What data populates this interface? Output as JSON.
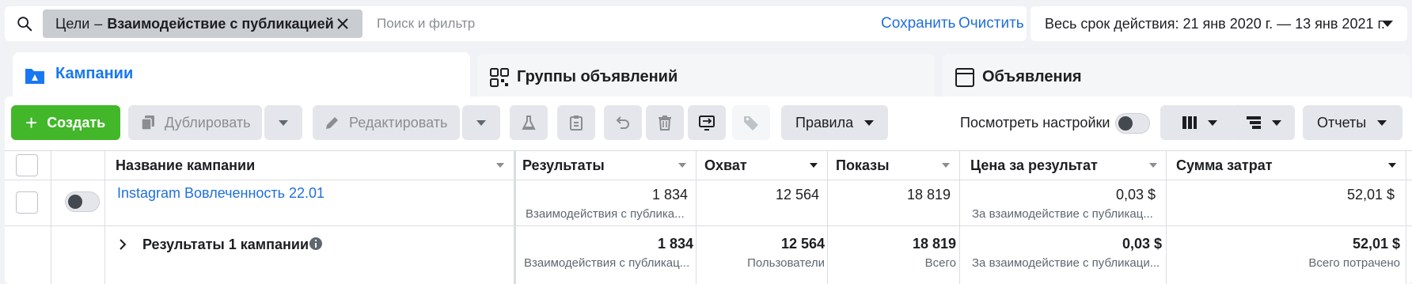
{
  "search": {
    "chip_prefix": "Цели",
    "chip_separator": "–",
    "chip_value": "Взаимодействие с публикацией",
    "placeholder": "Поиск и фильтр",
    "save_label": "Сохранить",
    "clear_label": "Очистить"
  },
  "date_range": {
    "label": "Весь срок действия: 21 янв 2020 г. — 13 янв 2021 г."
  },
  "tabs": [
    {
      "label": "Кампании",
      "active": true,
      "icon": "folder-icon"
    },
    {
      "label": "Группы объявлений",
      "active": false,
      "icon": "grid-icon"
    },
    {
      "label": "Объявления",
      "active": false,
      "icon": "ad-window-icon"
    }
  ],
  "toolbar": {
    "create_label": "Создать",
    "duplicate_label": "Дублировать",
    "edit_label": "Редактировать",
    "rules_label": "Правила",
    "view_settings_label": "Посмотреть настройки",
    "reports_label": "Отчеты"
  },
  "table": {
    "headers": [
      "Название кампании",
      "Результаты",
      "Охват",
      "Показы",
      "Цена за результат",
      "Сумма затрат"
    ],
    "row": {
      "name": "Instagram Вовлеченность 22.01",
      "results": "1 834",
      "results_sub": "Взаимодействия с публика...",
      "reach": "12 564",
      "impressions": "18 819",
      "cost": "0,03 $",
      "cost_sub": "За взаимодействие с публикац...",
      "spend": "52,01 $"
    },
    "totals": {
      "label": "Результаты 1 кампании",
      "results": "1 834",
      "results_sub": "Взаимодействия с публикац...",
      "reach": "12 564",
      "reach_sub": "Пользователи",
      "impressions": "18 819",
      "impressions_sub": "Всего",
      "cost": "0,03 $",
      "cost_sub": "За взаимодействие с публикаци...",
      "spend": "52,01 $",
      "spend_sub": "Всего потрачено"
    }
  },
  "colors": {
    "accent": "#1877f2",
    "link": "#216fdb",
    "create_green": "#42b72a"
  }
}
